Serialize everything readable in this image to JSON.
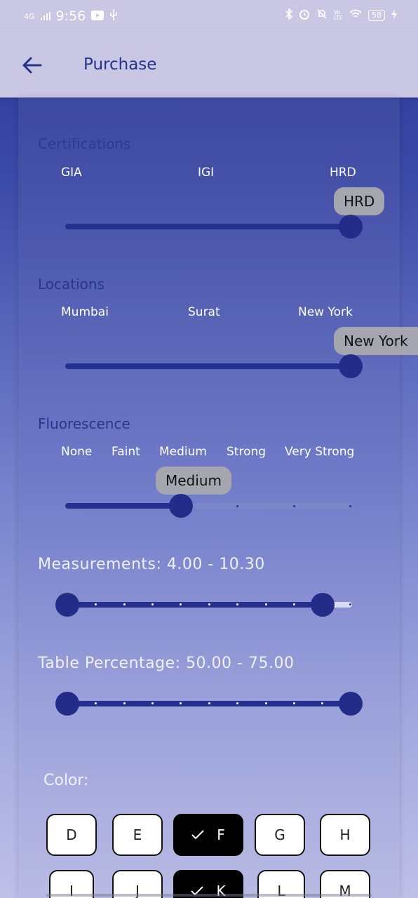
{
  "status_bar": {
    "network": "4G",
    "time": "9:56",
    "battery": "58"
  },
  "app_bar": {
    "title": "Purchase"
  },
  "certifications": {
    "title": "Certifications",
    "options": [
      "GIA",
      "IGI",
      "HRD"
    ],
    "selected": "HRD",
    "tooltip": "HRD"
  },
  "locations": {
    "title": "Locations",
    "options": [
      "Mumbai",
      "Surat",
      "New York"
    ],
    "selected": "New York",
    "tooltip": "New York"
  },
  "fluorescence": {
    "title": "Fluorescence",
    "options": [
      "None",
      "Faint",
      "Medium",
      "Strong",
      "Very Strong"
    ],
    "selected": "Medium",
    "tooltip": "Medium"
  },
  "measurements": {
    "label": "Measurements: 4.00 - 10.30",
    "min": 4.0,
    "max": 10.3
  },
  "table_percentage": {
    "label": "Table Percentage: 50.00 - 75.00",
    "min": 50.0,
    "max": 75.0
  },
  "color": {
    "label": "Color:",
    "row1": [
      {
        "label": "D",
        "selected": false
      },
      {
        "label": "E",
        "selected": false
      },
      {
        "label": "F",
        "selected": true
      },
      {
        "label": "G",
        "selected": false
      },
      {
        "label": "H",
        "selected": false
      }
    ],
    "row2": [
      {
        "label": "I",
        "selected": false
      },
      {
        "label": "J",
        "selected": false
      },
      {
        "label": "K",
        "selected": true
      },
      {
        "label": "L",
        "selected": false
      },
      {
        "label": "M",
        "selected": false
      }
    ]
  }
}
